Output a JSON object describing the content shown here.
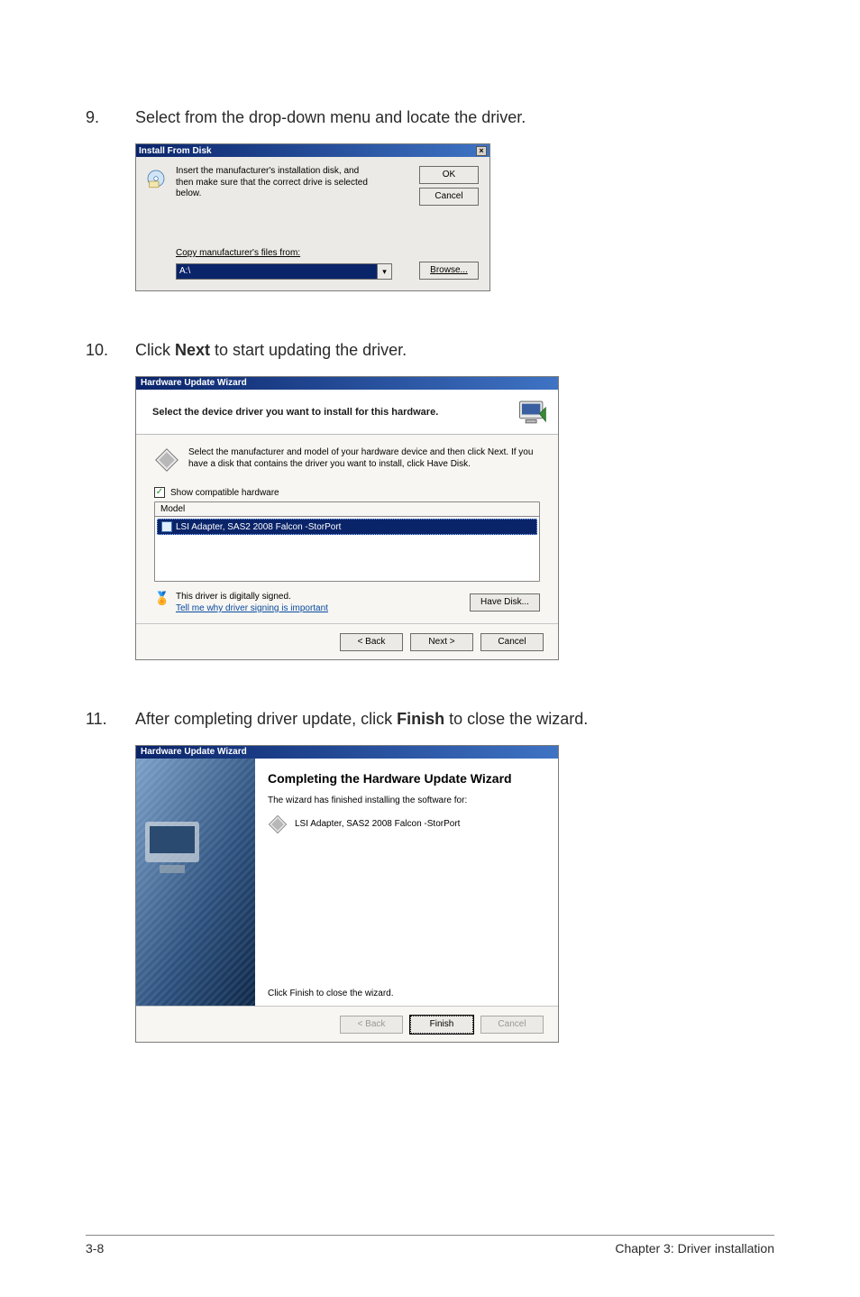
{
  "steps": {
    "s9": {
      "num": "9.",
      "pre": "Select from the drop-down menu and locate the driver."
    },
    "s10": {
      "num": "10.",
      "pre": "Click ",
      "bold": "Next",
      "post": " to start updating the driver."
    },
    "s11": {
      "num": "11.",
      "pre": "After completing driver update, click ",
      "bold": "Finish",
      "post": " to close the wizard."
    }
  },
  "dlg1": {
    "title": "Install From Disk",
    "msg": "Insert the manufacturer's installation disk, and then make sure that the correct drive is selected below.",
    "ok": "OK",
    "cancel": "Cancel",
    "copyLabelPre": "C",
    "copyLabelRest": "opy manufacturer's files from:",
    "pathValue": "A:\\",
    "browsePre": "B",
    "browseRest": "rowse..."
  },
  "dlg2": {
    "title": "Hardware Update Wizard",
    "header": "Select the device driver you want to install for this hardware.",
    "instr": "Select the manufacturer and model of your hardware device and then click Next. If you have a disk that contains the driver you want to install, click Have Disk.",
    "showCompat": "Show compatible hardware",
    "modelLabel": "Model",
    "listItem": "LSI Adapter, SAS2 2008 Falcon -StorPort",
    "signed": "This driver is digitally signed.",
    "tellMe": "Tell me why driver signing is important",
    "haveDisk": "Have Disk...",
    "back": "< Back",
    "next": "Next >",
    "cancel": "Cancel"
  },
  "dlg3": {
    "title": "Hardware Update Wizard",
    "heading": "Completing the Hardware Update Wizard",
    "sub": "The wizard has finished installing the software for:",
    "driver": "LSI Adapter, SAS2 2008 Falcon -StorPort",
    "closeHint": "Click Finish to close the wizard.",
    "back": "< Back",
    "finish": "Finish",
    "cancel": "Cancel"
  },
  "footer": {
    "left": "3-8",
    "right": "Chapter 3: Driver installation"
  }
}
